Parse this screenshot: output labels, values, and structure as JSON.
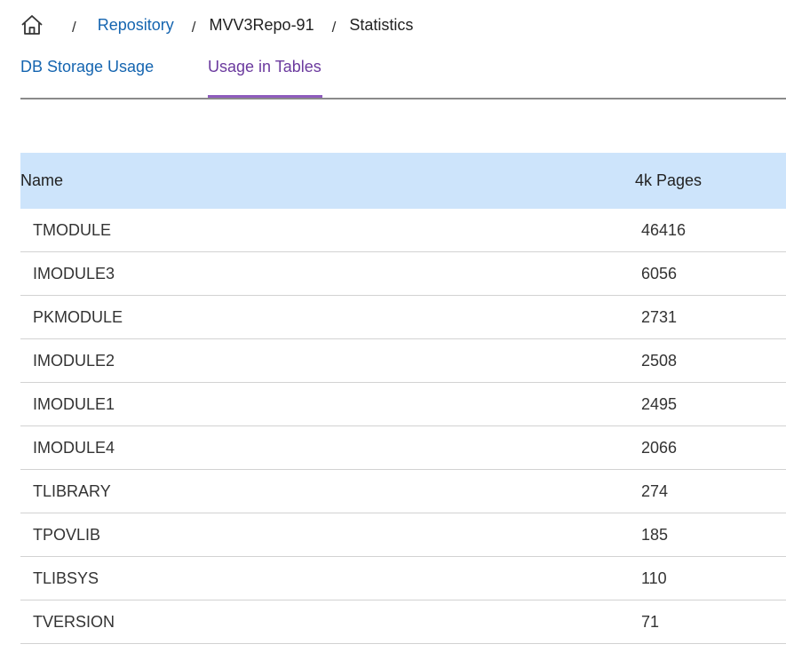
{
  "breadcrumb": {
    "home_icon": "home-icon",
    "items": [
      {
        "label": "Repository",
        "link": true
      },
      {
        "label": "MVV3Repo-91",
        "link": false
      },
      {
        "label": "Statistics",
        "link": false
      }
    ],
    "separator": "/"
  },
  "tabs": [
    {
      "label": "DB Storage Usage",
      "active": false
    },
    {
      "label": "Usage in Tables",
      "active": true
    }
  ],
  "table": {
    "headers": [
      "Name",
      "4k Pages"
    ],
    "rows": [
      {
        "name": "TMODULE",
        "pages": "46416"
      },
      {
        "name": "IMODULE3",
        "pages": "6056"
      },
      {
        "name": "PKMODULE",
        "pages": "2731"
      },
      {
        "name": "IMODULE2",
        "pages": "2508"
      },
      {
        "name": "IMODULE1",
        "pages": "2495"
      },
      {
        "name": "IMODULE4",
        "pages": "2066"
      },
      {
        "name": "TLIBRARY",
        "pages": "274"
      },
      {
        "name": "TPOVLIB",
        "pages": "185"
      },
      {
        "name": "TLIBSYS",
        "pages": "110"
      },
      {
        "name": "TVERSION",
        "pages": "71"
      }
    ]
  },
  "colors": {
    "link": "#1565b0",
    "active_tab": "#6b3a9e",
    "header_bg": "#cde4fb"
  }
}
